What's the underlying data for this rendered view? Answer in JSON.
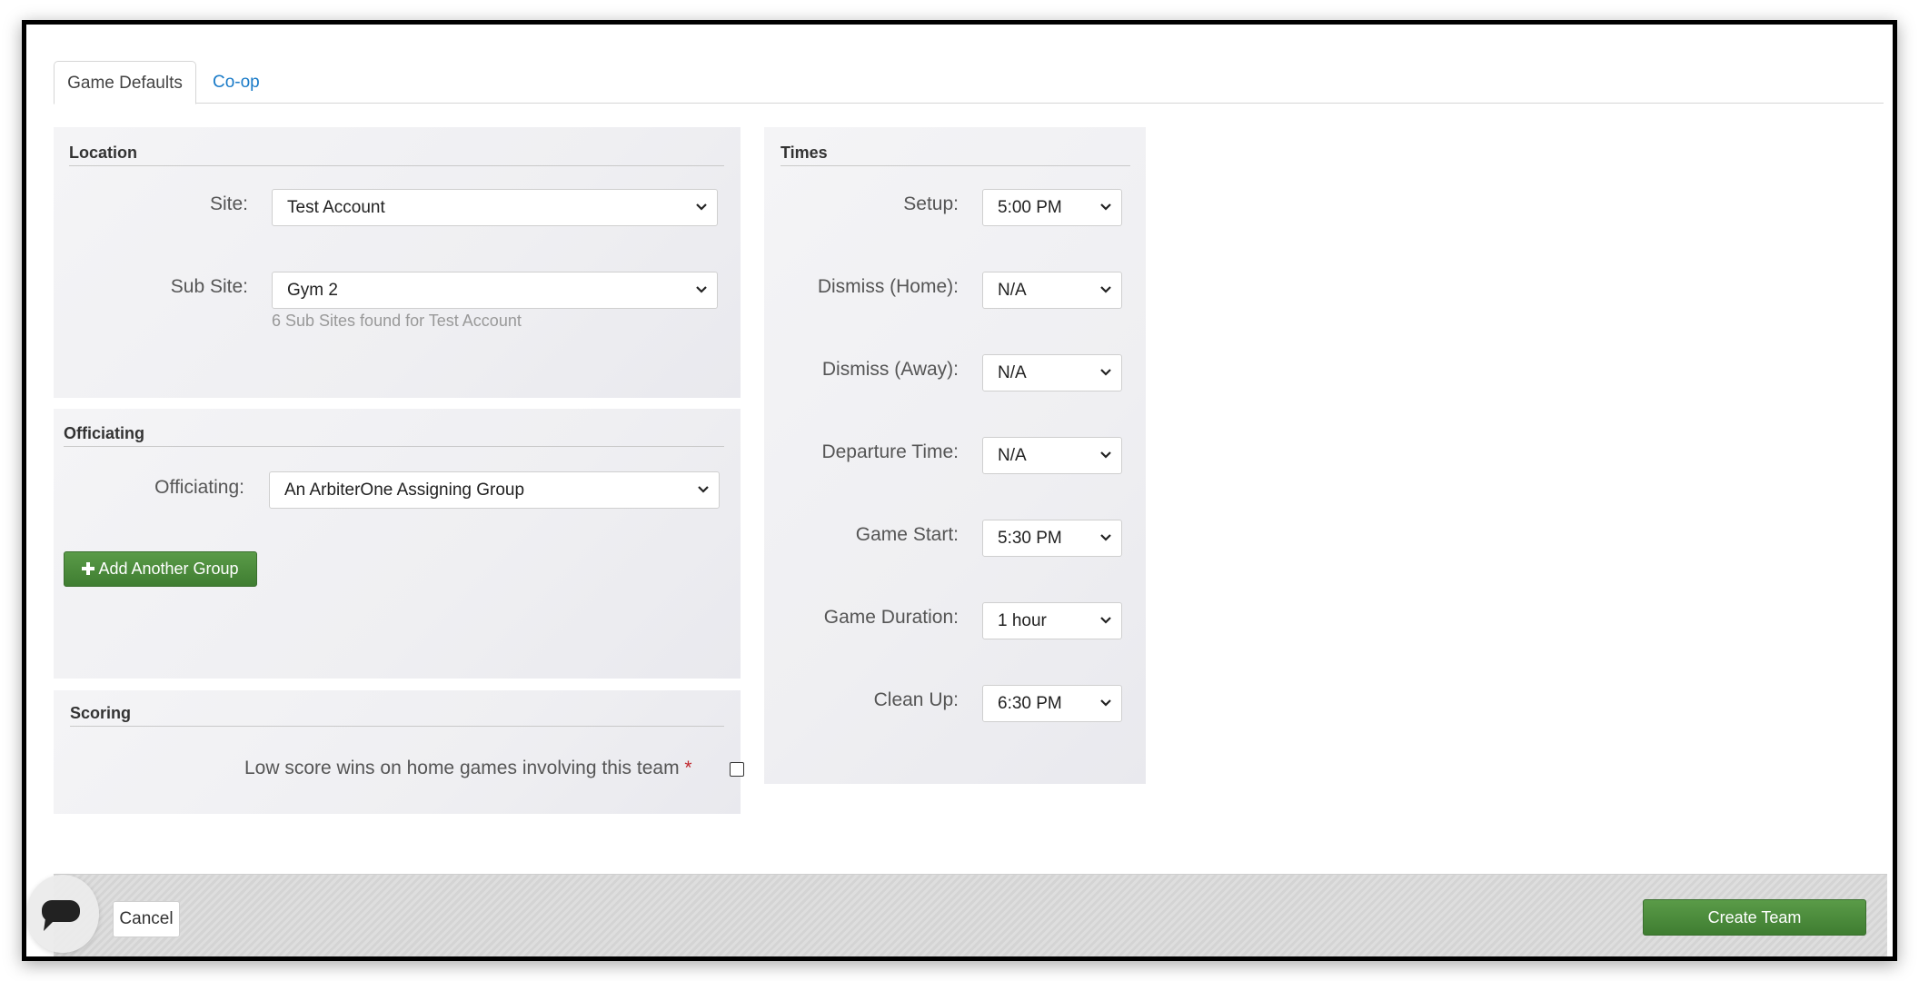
{
  "tabs": [
    {
      "label": "Game Defaults",
      "active": true
    },
    {
      "label": "Co-op",
      "active": false
    }
  ],
  "location": {
    "title": "Location",
    "site_label": "Site:",
    "site_value": "Test Account",
    "subsite_label": "Sub Site:",
    "subsite_value": "Gym 2",
    "subsite_hint": "6 Sub Sites found for Test Account"
  },
  "officiating": {
    "title": "Officiating",
    "label": "Officiating:",
    "value": "An ArbiterOne Assigning Group",
    "add_button": "Add Another Group"
  },
  "scoring": {
    "title": "Scoring",
    "low_score_label": "Low score wins on home games involving this team",
    "required_mark": "*",
    "low_score_checked": false
  },
  "times": {
    "title": "Times",
    "fields": [
      {
        "label": "Setup:",
        "value": "5:00 PM"
      },
      {
        "label": "Dismiss (Home):",
        "value": "N/A"
      },
      {
        "label": "Dismiss (Away):",
        "value": "N/A"
      },
      {
        "label": "Departure Time:",
        "value": "N/A"
      },
      {
        "label": "Game Start:",
        "value": "5:30 PM"
      },
      {
        "label": "Game Duration:",
        "value": "1 hour"
      },
      {
        "label": "Clean Up:",
        "value": "6:30 PM"
      }
    ]
  },
  "footer": {
    "cancel_label": "Cancel",
    "create_label": "Create Team"
  },
  "colors": {
    "accent_green": "#4a8a3b",
    "link_blue": "#1a7bc8",
    "required_red": "#c0272d"
  },
  "icons": {
    "chevron": "chevron-down-icon",
    "plus": "plus-icon",
    "chat": "chat-icon"
  }
}
